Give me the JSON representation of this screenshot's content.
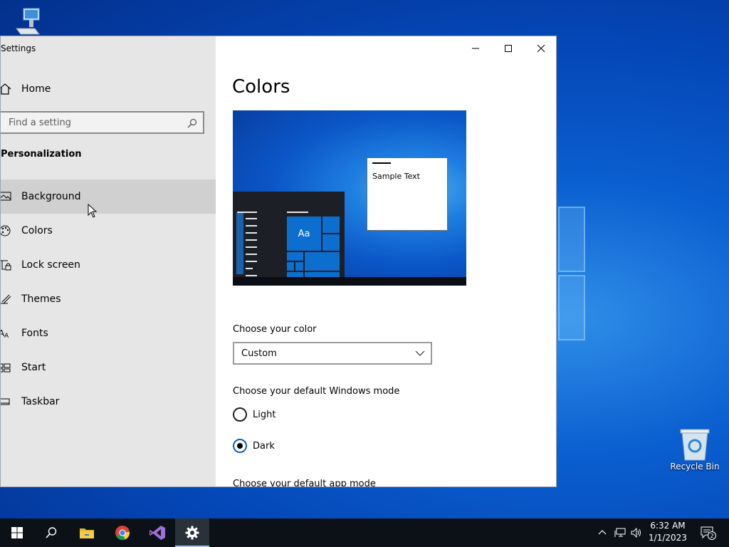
{
  "desktop": {
    "recycle_bin_label": "Recycle Bin"
  },
  "window": {
    "app_title": "Settings"
  },
  "sidebar": {
    "home_label": "Home",
    "search_placeholder": "Find a setting",
    "section_title": "Personalization",
    "items": [
      {
        "label": "Background",
        "icon": "picture-icon",
        "hover": true
      },
      {
        "label": "Colors",
        "icon": "palette-icon"
      },
      {
        "label": "Lock screen",
        "icon": "lock-screen-icon"
      },
      {
        "label": "Themes",
        "icon": "brush-icon"
      },
      {
        "label": "Fonts",
        "icon": "fonts-icon"
      },
      {
        "label": "Start",
        "icon": "start-icon"
      },
      {
        "label": "Taskbar",
        "icon": "taskbar-icon"
      }
    ]
  },
  "content": {
    "title": "Colors",
    "preview": {
      "sample_text": "Sample Text",
      "tile_text": "Aa"
    },
    "choose_color_label": "Choose your color",
    "color_value": "Custom",
    "windows_mode_label": "Choose your default Windows mode",
    "windows_mode_options": [
      {
        "label": "Light",
        "checked": false
      },
      {
        "label": "Dark",
        "checked": true
      }
    ],
    "app_mode_label": "Choose your default app mode"
  },
  "taskbar": {
    "apps": [
      "start-icon",
      "search-icon",
      "file-explorer-icon",
      "chrome-icon",
      "visual-studio-icon",
      "settings-icon"
    ],
    "active_app": "settings-icon",
    "clock_time": "6:32 AM",
    "clock_date": "1/1/2023",
    "notification_count": "2"
  },
  "colors": {
    "accent": "#0078d7",
    "sidebar_bg": "#e6e6e6",
    "taskbar_bg": "#0c1118"
  }
}
